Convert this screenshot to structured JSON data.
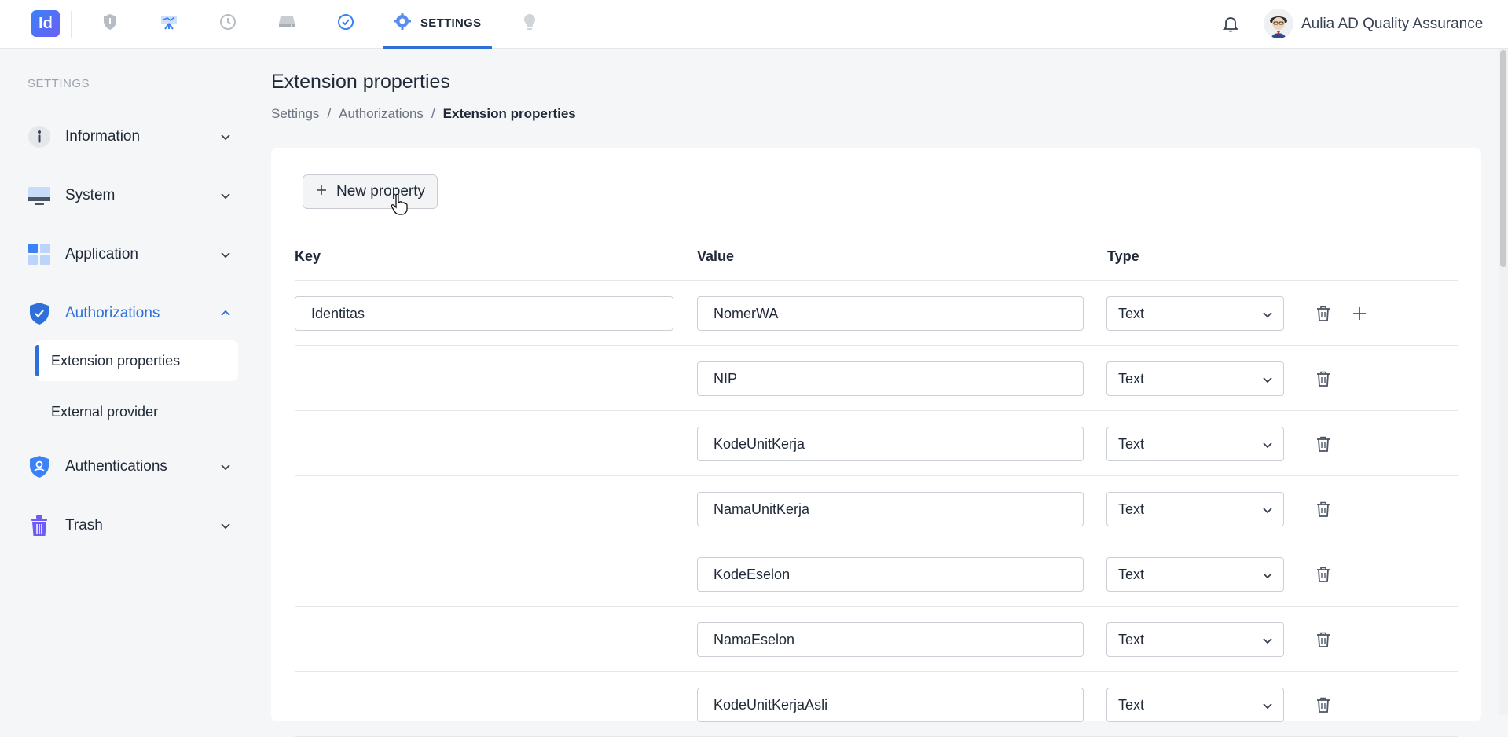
{
  "topbar": {
    "logo_text": "Id",
    "nav": [
      {
        "icon": "shield-icon"
      },
      {
        "icon": "presentation-icon"
      },
      {
        "icon": "history-icon"
      },
      {
        "icon": "drive-icon"
      },
      {
        "icon": "check-circle-icon"
      },
      {
        "icon": "gear-icon",
        "label": "SETTINGS",
        "active": true
      },
      {
        "icon": "bulb-icon"
      }
    ],
    "settings_label": "SETTINGS",
    "user_name": "Aulia AD Quality Assurance"
  },
  "sidebar": {
    "heading": "SETTINGS",
    "items": [
      {
        "label": "Information",
        "icon": "info-icon"
      },
      {
        "label": "System",
        "icon": "monitor-icon"
      },
      {
        "label": "Application",
        "icon": "grid-icon"
      },
      {
        "label": "Authorizations",
        "icon": "shield-check-icon",
        "active": true
      },
      {
        "label": "Authentications",
        "icon": "shield-user-icon"
      },
      {
        "label": "Trash",
        "icon": "trash-icon"
      }
    ],
    "submenu": [
      {
        "label": "Extension properties",
        "active": true
      },
      {
        "label": "External provider"
      }
    ]
  },
  "main": {
    "title": "Extension properties",
    "breadcrumb": [
      "Settings",
      "Authorizations",
      "Extension properties"
    ],
    "new_button_label": "New property",
    "columns": [
      "Key",
      "Value",
      "Type"
    ],
    "rows": [
      {
        "key": "Identitas",
        "value": "NomerWA",
        "type": "Text"
      },
      {
        "key": "",
        "value": "NIP",
        "type": "Text"
      },
      {
        "key": "",
        "value": "KodeUnitKerja",
        "type": "Text"
      },
      {
        "key": "",
        "value": "NamaUnitKerja",
        "type": "Text"
      },
      {
        "key": "",
        "value": "KodeEselon",
        "type": "Text"
      },
      {
        "key": "",
        "value": "NamaEselon",
        "type": "Text"
      },
      {
        "key": "",
        "value": "KodeUnitKerjaAsli",
        "type": "Text"
      }
    ]
  },
  "colors": {
    "accent": "#2f6fdc",
    "text": "#1f2937",
    "muted": "#6b7280"
  }
}
